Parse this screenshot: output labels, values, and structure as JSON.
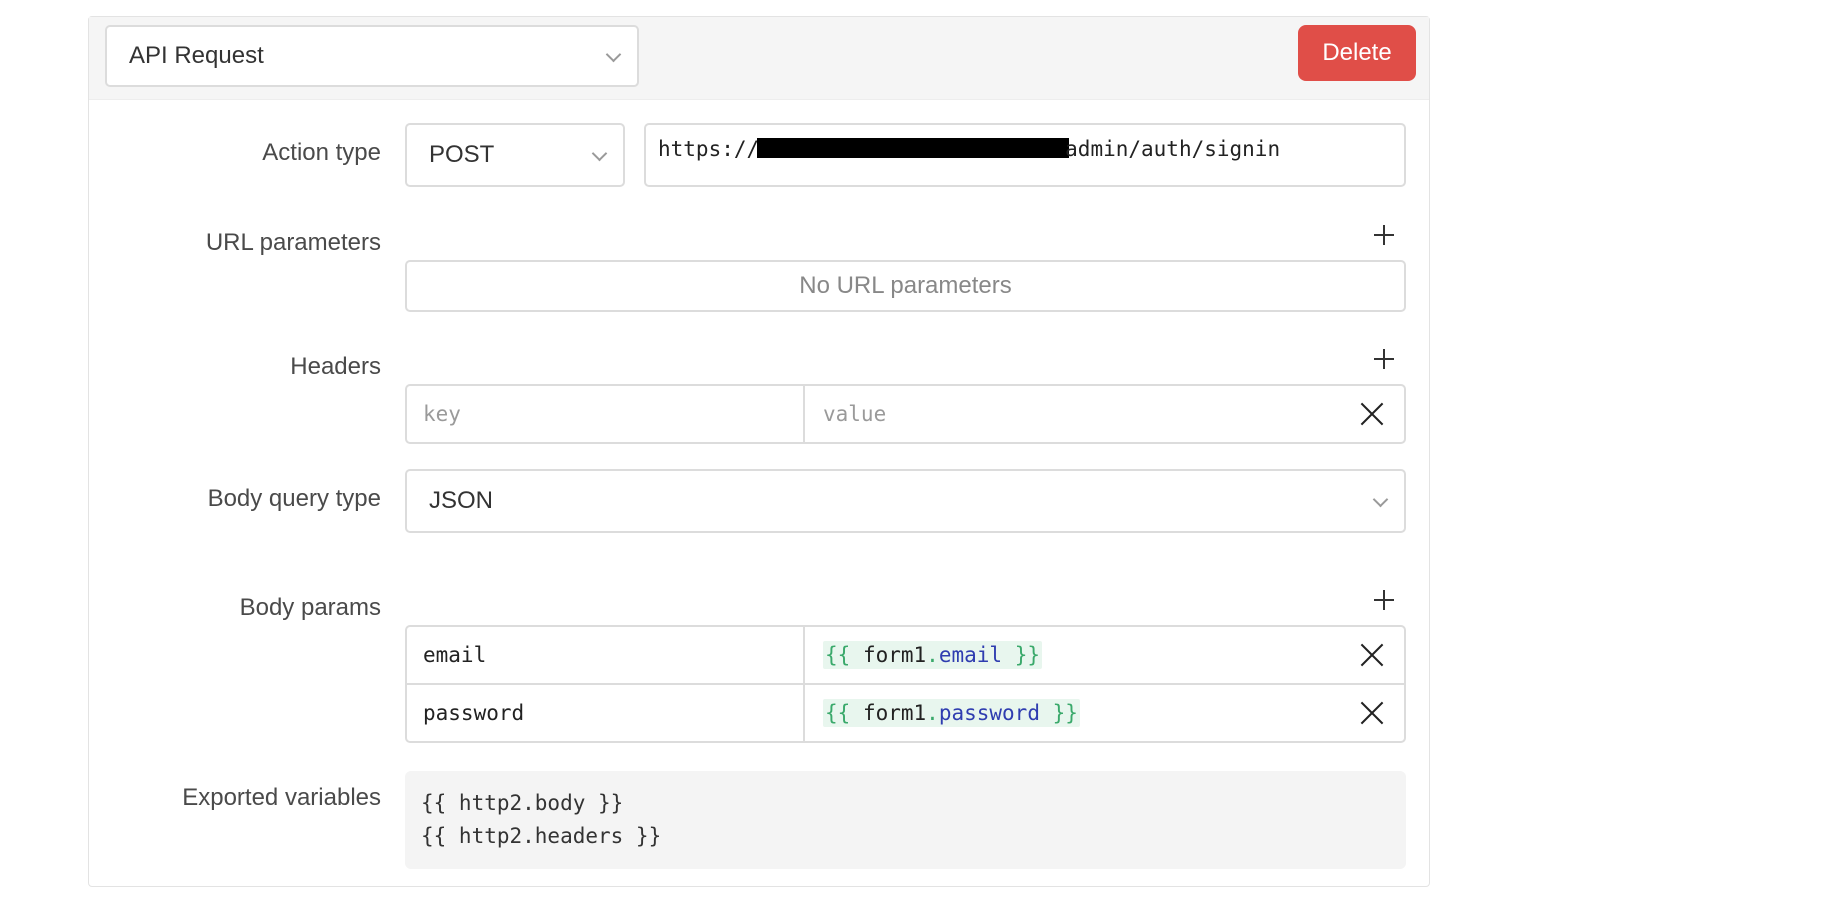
{
  "action": {
    "name": "API Request",
    "delete_label": "Delete"
  },
  "labels": {
    "action_type": "Action type",
    "url_parameters": "URL parameters",
    "headers": "Headers",
    "body_query_type": "Body query type",
    "body_params": "Body params",
    "exported_variables": "Exported variables"
  },
  "request": {
    "method": "POST",
    "url_prefix": "https://",
    "url_suffix": "admin/auth/signin"
  },
  "url_parameters": {
    "empty_text": "No URL parameters"
  },
  "headers": [
    {
      "key_placeholder": "key",
      "value_placeholder": "value"
    }
  ],
  "body_query_type": "JSON",
  "body_params": [
    {
      "key": "email",
      "open": "{{",
      "object": "form1",
      "dot": ".",
      "property": "email",
      "close": "}}"
    },
    {
      "key": "password",
      "open": "{{",
      "object": "form1",
      "dot": ".",
      "property": "password",
      "close": "}}"
    }
  ],
  "exported_variables": [
    "{{ http2.body }}",
    "{{ http2.headers }}"
  ],
  "icons": {
    "add": "plus-icon",
    "remove": "close-icon",
    "dropdown": "chevron-down-icon"
  },
  "colors": {
    "delete_button": "#e04e48",
    "template_brace": "#3aa96b",
    "template_property": "#2f3db0"
  }
}
